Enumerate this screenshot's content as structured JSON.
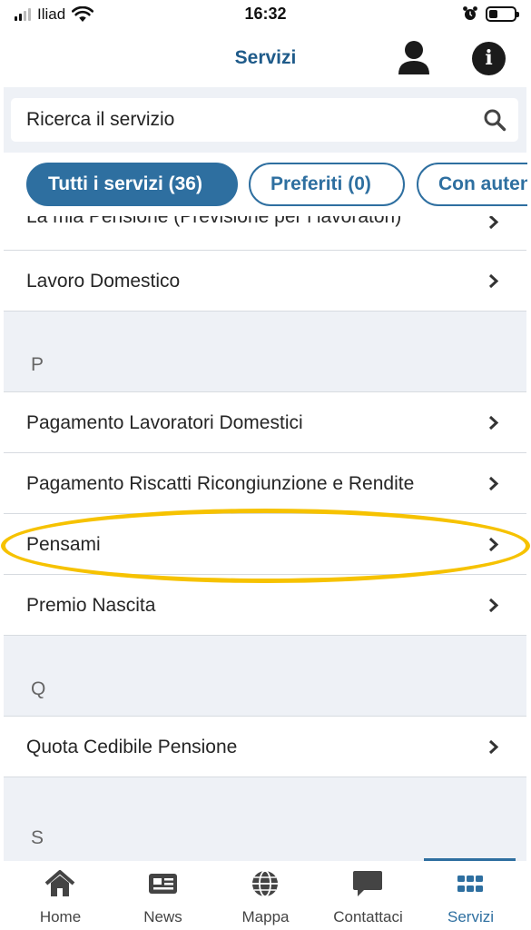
{
  "status_bar": {
    "carrier": "Iliad",
    "time": "16:32",
    "battery_level": 0.35,
    "signal_bars": 2
  },
  "header": {
    "title": "Servizi",
    "user_icon": "user-icon",
    "info_icon": "info-icon"
  },
  "search": {
    "placeholder": "Ricerca il servizio"
  },
  "filters": [
    {
      "label": "Tutti i servizi (36)",
      "active": true
    },
    {
      "label": "Preferiti (0)",
      "active": false
    },
    {
      "label": "Con autent",
      "active": false
    }
  ],
  "list": {
    "row_partial": "La mia Pensione (Previsione per i lavoratori)",
    "row_lavoro": "Lavoro Domestico",
    "section_p": "P",
    "row_pagamento_lav": "Pagamento Lavoratori Domestici",
    "row_pagamento_ris": "Pagamento Riscatti Ricongiunzione e Rendite",
    "row_pensami": "Pensami",
    "row_premio": "Premio Nascita",
    "section_q": "Q",
    "row_quota": "Quota Cedibile Pensione",
    "section_s": "S"
  },
  "tabs": [
    {
      "label": "Home",
      "icon": "home-icon"
    },
    {
      "label": "News",
      "icon": "news-icon"
    },
    {
      "label": "Mappa",
      "icon": "globe-icon"
    },
    {
      "label": "Contattaci",
      "icon": "chat-icon"
    },
    {
      "label": "Servizi",
      "icon": "grid-icon",
      "active": true
    }
  ],
  "colors": {
    "accent": "#2e6fa0",
    "title": "#1f5b8a",
    "highlight": "#f6c200",
    "section_bg": "#eef1f6"
  }
}
